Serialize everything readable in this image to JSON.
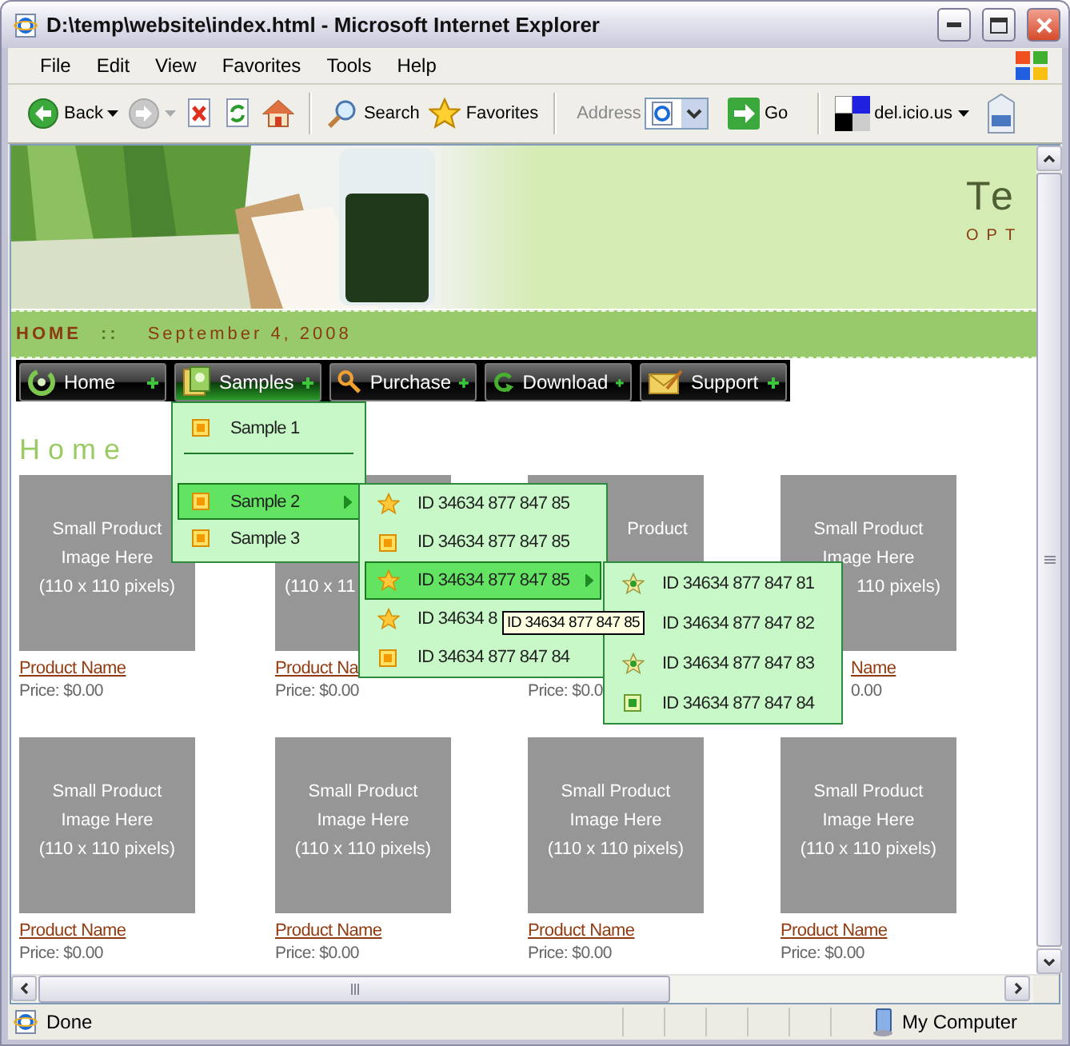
{
  "window": {
    "title": "D:\\temp\\website\\index.html - Microsoft Internet Explorer"
  },
  "menu_bar": [
    {
      "label": "File"
    },
    {
      "label": "Edit"
    },
    {
      "label": "View"
    },
    {
      "label": "Favorites"
    },
    {
      "label": "Tools"
    },
    {
      "label": "Help"
    }
  ],
  "toolbar": [
    {
      "kind": "back",
      "label": "Back",
      "disabled": false
    },
    {
      "kind": "forward",
      "disabled": true
    },
    {
      "kind": "stop",
      "disabled": false
    },
    {
      "kind": "refresh",
      "disabled": false
    },
    {
      "kind": "home",
      "disabled": false
    },
    {
      "kind": "separator"
    },
    {
      "kind": "search",
      "label": "Search",
      "disabled": false
    },
    {
      "kind": "favorites",
      "label": "Favorites",
      "disabled": false
    }
  ],
  "address_bar": {
    "label": "Address",
    "go": "Go"
  },
  "links_bar": {
    "label": "del.icio.us"
  },
  "page": {
    "header": {
      "title": "Te",
      "subtitle": "OPT"
    },
    "breadcrumb": {
      "home": "HOME",
      "separator": "::",
      "date": "September 4, 2008"
    },
    "nav": [
      {
        "label": "Home",
        "selected": false
      },
      {
        "label": "Samples",
        "selected": true,
        "expanded": true,
        "children": [
          {
            "kind": "square",
            "label": "Sample 1",
            "selected": false
          },
          {
            "kind": "separator"
          },
          {
            "kind": "square",
            "label": "Sample 2",
            "selected": true,
            "expanded": true,
            "children": [
              {
                "kind": "star",
                "label": "ID 34634 877 847 85",
                "selected": false
              },
              {
                "kind": "square",
                "label": "ID 34634 877 847 85",
                "selected": false
              },
              {
                "kind": "star",
                "label": "ID 34634 877 847 85",
                "selected": true,
                "expanded": true,
                "children": [
                  {
                    "kind": "star",
                    "label": "ID 34634 877 847 81",
                    "selected": false
                  },
                  {
                    "kind": "text",
                    "label": "ID 34634 877 847 82",
                    "selected": false
                  },
                  {
                    "kind": "star",
                    "label": "ID 34634 877 847 83",
                    "selected": false
                  },
                  {
                    "kind": "square",
                    "label": "ID 34634 877 847 84",
                    "selected": false
                  }
                ]
              },
              {
                "kind": "star",
                "label": "ID 34634 8",
                "selected": false
              },
              {
                "kind": "square",
                "label": "ID 34634 877 847 84",
                "selected": false
              }
            ]
          },
          {
            "kind": "square",
            "label": "Sample 3",
            "selected": false
          }
        ]
      },
      {
        "label": "Purchase",
        "selected": false
      },
      {
        "label": "Download",
        "selected": false
      },
      {
        "label": "Support",
        "selected": false
      }
    ],
    "heading": "Home",
    "products": [
      {
        "kind": "whole",
        "lines": [
          {
            "kind": "whole",
            "text": "Small Product"
          },
          {
            "kind": "whole",
            "text": "Image Here"
          },
          {
            "kind": "whole",
            "text": "(110 x 110 pixels)"
          }
        ],
        "name": "Product Name",
        "price": "Price: $0.00"
      },
      {
        "kind": "covered-top",
        "lines": [
          {
            "kind": "right-cut",
            "text": "(110 x 11"
          }
        ],
        "name": "Product Na",
        "price": "Price: $0.00"
      },
      {
        "kind": "whole",
        "lines": [
          {
            "kind": "left-cut",
            "text": "Product"
          }
        ],
        "price": "Price: $0.0"
      },
      {
        "kind": "left-cut",
        "lines": [
          {
            "kind": "whole",
            "text": "Small Product"
          },
          {
            "kind": "whole",
            "text": "Image Here"
          },
          {
            "kind": "left-cut",
            "text": "110 pixels)"
          }
        ],
        "name": "Name",
        "price": "0.00"
      },
      {
        "kind": "whole",
        "lines": [
          {
            "kind": "whole",
            "text": "Small Product"
          },
          {
            "kind": "whole",
            "text": "Image Here"
          },
          {
            "kind": "whole",
            "text": "(110 x 110 pixels)"
          }
        ],
        "name": "Product Name",
        "price": "Price: $0.00"
      },
      {
        "kind": "whole",
        "lines": [
          {
            "kind": "whole",
            "text": "Small Product"
          },
          {
            "kind": "whole",
            "text": "Image Here"
          },
          {
            "kind": "whole",
            "text": "(110 x 110 pixels)"
          }
        ],
        "name": "Product Name",
        "price": "Price: $0.00"
      },
      {
        "kind": "whole",
        "lines": [
          {
            "kind": "whole",
            "text": "Small Product"
          },
          {
            "kind": "whole",
            "text": "Image Here"
          },
          {
            "kind": "whole",
            "text": "(110 x 110 pixels)"
          }
        ],
        "name": "Product Name",
        "price": "Price: $0.00"
      },
      {
        "kind": "whole",
        "lines": [
          {
            "kind": "whole",
            "text": "Small Product"
          },
          {
            "kind": "whole",
            "text": "Image Here"
          },
          {
            "kind": "whole",
            "text": "(110 x 110 pixels)"
          }
        ],
        "name": "Product Name",
        "price": "Price: $0.00"
      }
    ],
    "tooltip": "ID 34634 877 847 85"
  },
  "status_bar": {
    "text": "Done",
    "zone": "My Computer"
  }
}
